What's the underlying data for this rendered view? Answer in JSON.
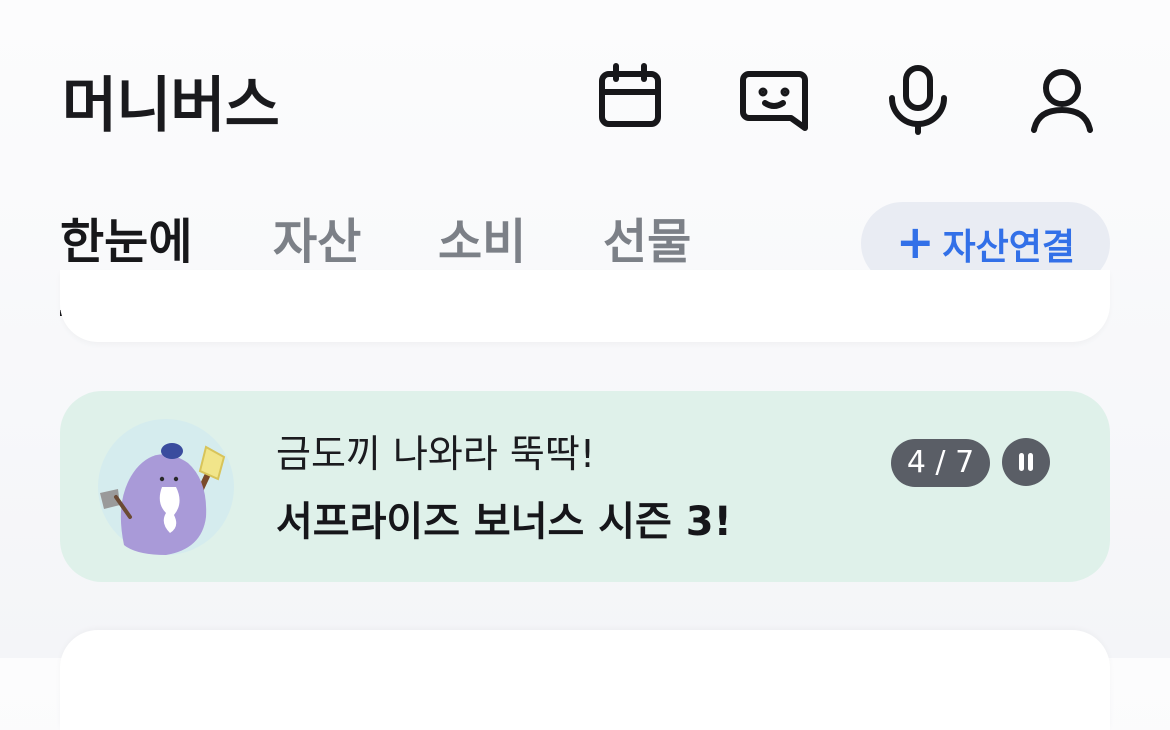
{
  "header": {
    "title": "머니버스",
    "icons": [
      "calendar-icon",
      "chat-smile-icon",
      "microphone-icon",
      "user-icon"
    ]
  },
  "tabs": [
    {
      "label": "한눈에",
      "active": true
    },
    {
      "label": "자산",
      "active": false
    },
    {
      "label": "소비",
      "active": false
    },
    {
      "label": "선물",
      "active": false
    }
  ],
  "connect_button": {
    "icon": "plus-icon",
    "label": "자산연결"
  },
  "banner": {
    "title": "금도끼 나와라 뚝딱!",
    "subtitle": "서프라이즈 보너스 시즌 3!",
    "counter": "4 / 7",
    "background": "#dff1ea",
    "icon": "purple-character-with-axe"
  },
  "colors": {
    "accent": "#3270e8",
    "text_primary": "#17171a",
    "text_inactive": "#7c8087"
  }
}
